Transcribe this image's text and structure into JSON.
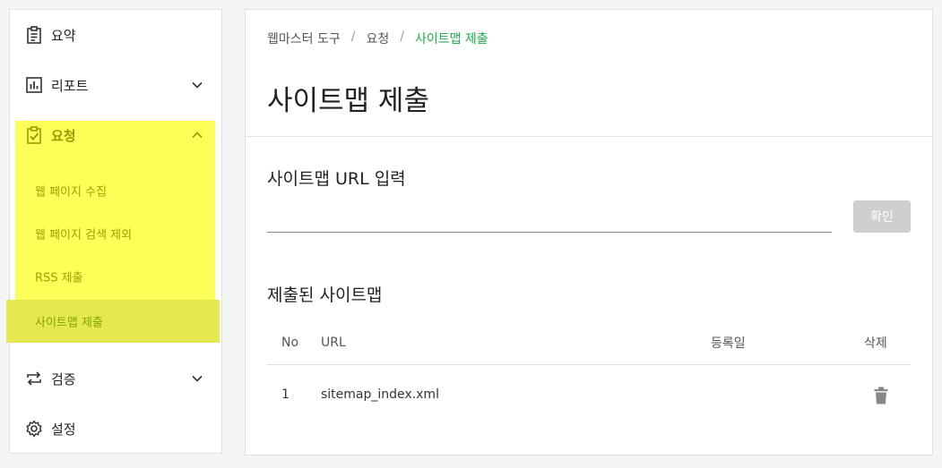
{
  "sidebar": {
    "items": [
      {
        "label": "요약",
        "icon": "clipboard-list-icon"
      },
      {
        "label": "리포트",
        "icon": "bar-chart-icon"
      },
      {
        "label": "요청",
        "icon": "clipboard-check-icon"
      },
      {
        "label": "검증",
        "icon": "repeat-icon"
      },
      {
        "label": "설정",
        "icon": "gear-icon"
      }
    ],
    "sub_items": [
      {
        "label": "웹 페이지 수집"
      },
      {
        "label": "웹 페이지 검색 제외"
      },
      {
        "label": "RSS 제출"
      },
      {
        "label": "사이트맵 제출"
      }
    ]
  },
  "breadcrumb": {
    "items": [
      "웹마스터 도구",
      "요청",
      "사이트맵 제출"
    ],
    "separator": "/"
  },
  "main": {
    "title": "사이트맵 제출",
    "input_section_title": "사이트맵 URL 입력",
    "input_value": "",
    "confirm_label": "확인",
    "list_section_title": "제출된 사이트맵",
    "table": {
      "headers": [
        "No",
        "URL",
        "등록일",
        "삭제"
      ],
      "rows": [
        {
          "no": "1",
          "url": "sitemap_index.xml",
          "date": ""
        }
      ]
    }
  },
  "colors": {
    "accent_green": "#19b24b",
    "highlight_yellow": "#fdff59",
    "button_disabled": "#cfcfcf"
  }
}
